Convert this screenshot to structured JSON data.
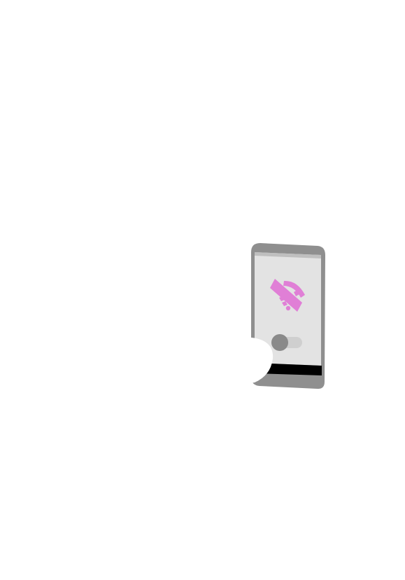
{
  "illustration": {
    "subject": "phone-wifi-off",
    "icon": "wifi-off-icon",
    "toggle_state": "off",
    "colors": {
      "background": "#ffffff",
      "phone_body": "#8f8f8f",
      "screen": "#e3e3e3",
      "screen_top_strip": "#bfbfbf",
      "icon": "#e07fd6",
      "toggle_track": "#cfcfcf",
      "toggle_knob": "#8a8a8a",
      "bottom_bar": "#000000",
      "finger": "#ffffff"
    }
  }
}
